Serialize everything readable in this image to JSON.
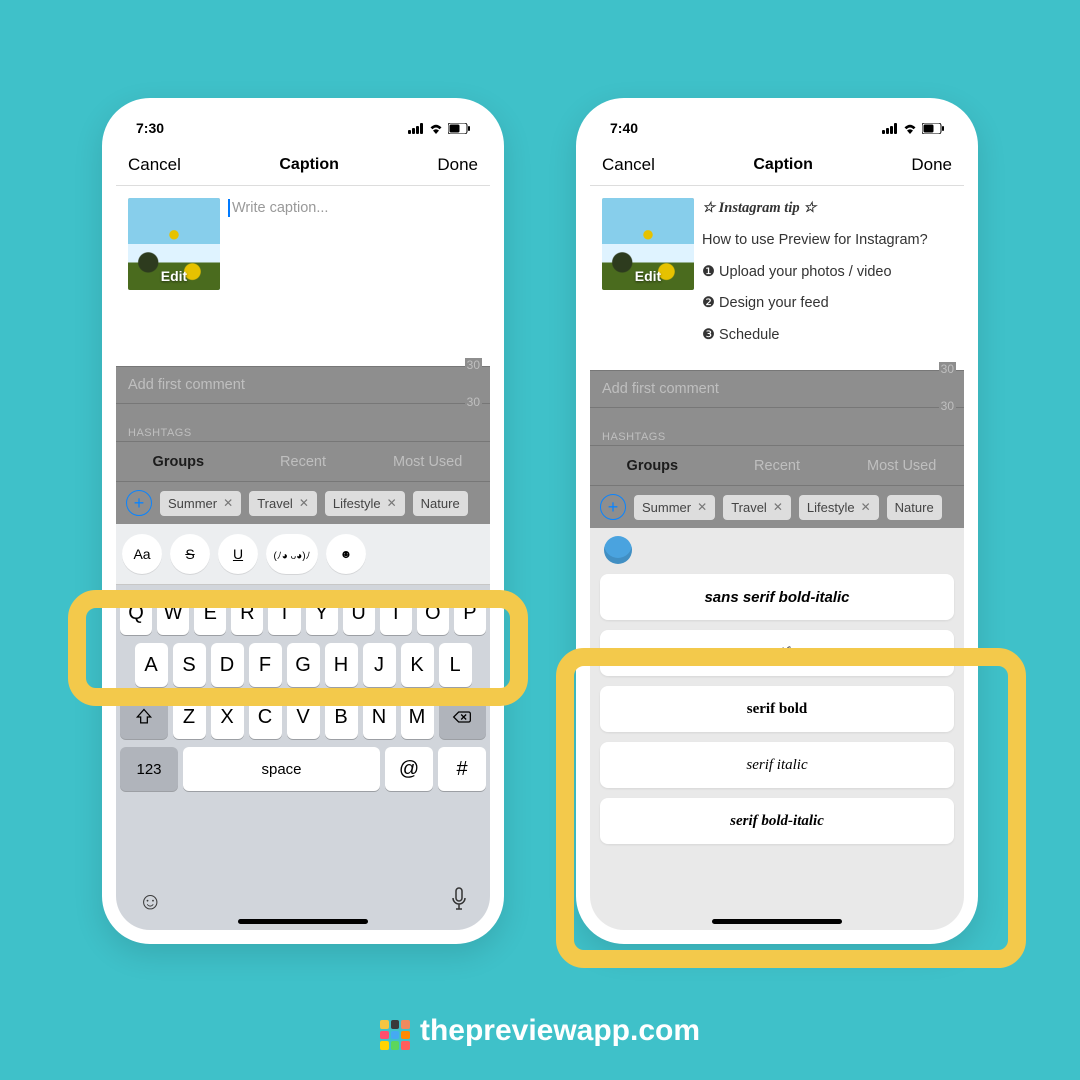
{
  "page_bg": "#3fc1c9",
  "footer_text": "thepreviewapp.com",
  "logo_colors": [
    "#f5c542",
    "#3a3a3a",
    "#f08a5d",
    "#ff4d6d",
    "#45aaf2",
    "#ff8a00",
    "#ffd400",
    "#5cd65c",
    "#ff5e5b"
  ],
  "status_right_icons": [
    "signal",
    "wifi",
    "battery"
  ],
  "nav": {
    "left": "Cancel",
    "title": "Caption",
    "right": "Done"
  },
  "thumb_label": "Edit",
  "left": {
    "time": "7:30",
    "caption_placeholder": "Write caption..."
  },
  "right": {
    "time": "7:40",
    "caption_title": "☆ Instagram tip ☆",
    "caption_q": "How to use Preview for Instagram?",
    "steps": [
      "❶ Upload your photos / video",
      "❷ Design your feed",
      "❸ Schedule"
    ]
  },
  "gray": {
    "count": "30",
    "first_comment": "Add first comment",
    "hashtags_label": "HASHTAGS",
    "tabs": [
      "Groups",
      "Recent",
      "Most Used"
    ],
    "tags": [
      "Summer",
      "Travel",
      "Lifestyle",
      "Nature"
    ]
  },
  "font_toolbar": {
    "aa": "Aa",
    "kaomoji": "(ﾉ◕ ᴗ◕)ﾉ",
    "emoji": "☻"
  },
  "keyboard": {
    "row1": [
      "Q",
      "W",
      "E",
      "R",
      "T",
      "Y",
      "U",
      "I",
      "O",
      "P"
    ],
    "row2": [
      "A",
      "S",
      "D",
      "F",
      "G",
      "H",
      "J",
      "K",
      "L"
    ],
    "row3": [
      "Z",
      "X",
      "C",
      "V",
      "B",
      "N",
      "M"
    ],
    "num": "123",
    "space": "space",
    "at": "@",
    "hash": "#"
  },
  "font_options": [
    {
      "label": "sans serif bold-italic",
      "cls": "fo-sans-bi"
    },
    {
      "label": "serif",
      "cls": "fo-serif"
    },
    {
      "label": "serif bold",
      "cls": "fo-serif-b"
    },
    {
      "label": "serif italic",
      "cls": "fo-serif-i"
    },
    {
      "label": "serif bold-italic",
      "cls": "fo-serif-bi"
    }
  ]
}
